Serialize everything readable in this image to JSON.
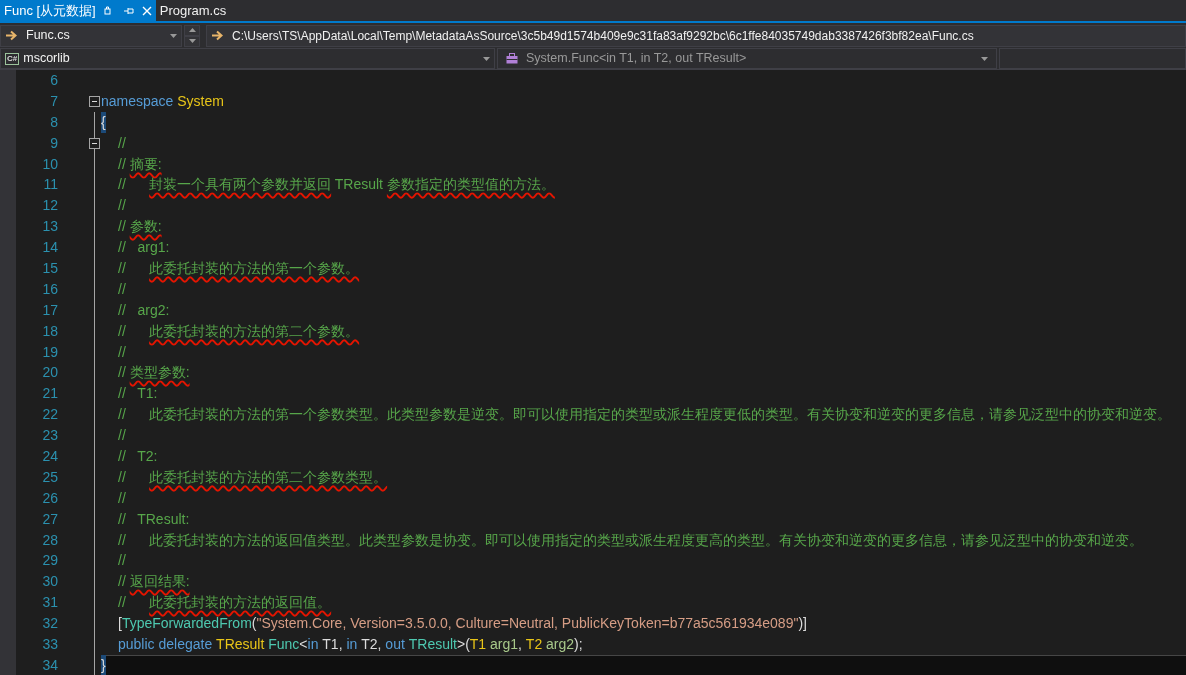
{
  "tabs": [
    {
      "label": "Func [从元数据]",
      "selected": true,
      "pinned": true
    },
    {
      "label": "Program.cs",
      "selected": false,
      "pinned": false
    }
  ],
  "navigation": {
    "file_dropdown": "Func.cs",
    "path": "C:\\Users\\TS\\AppData\\Local\\Temp\\MetadataAsSource\\3c5b49d1574b409e9c31fa83af9292bc\\6c1ffe84035749dab3387426f3bf82ea\\Func.cs",
    "project_icon_text": "C#",
    "project_dropdown": "mscorlib",
    "member_dropdown": "System.Func<in T1, in T2, out TResult>"
  },
  "lines": [
    {
      "number": "6",
      "kind": "blank",
      "fold": false,
      "current": false
    },
    {
      "number": "7",
      "kind": "namespace",
      "fold": true,
      "current": false,
      "tokens": [
        {
          "kind": "keyword",
          "text": "namespace "
        },
        {
          "kind": "typeparam",
          "text": "System"
        }
      ]
    },
    {
      "number": "8",
      "kind": "namespace",
      "fold": false,
      "current": false,
      "tokens": [
        {
          "kind": "brace",
          "text": "{"
        }
      ]
    },
    {
      "number": "9",
      "kind": "member",
      "fold": true,
      "current": false,
      "tokens": [
        {
          "kind": "comment",
          "text": "//",
          "squiggle": false
        }
      ]
    },
    {
      "number": "10",
      "kind": "member",
      "fold": false,
      "current": false,
      "tokens": [
        {
          "kind": "comment",
          "text": "// ",
          "squiggle": false
        },
        {
          "kind": "comment",
          "text": "摘要:",
          "squiggle": true
        }
      ]
    },
    {
      "number": "11",
      "kind": "member",
      "fold": false,
      "current": false,
      "tokens": [
        {
          "kind": "comment",
          "text": "//      ",
          "squiggle": false
        },
        {
          "kind": "comment",
          "text": "封装一个具有两个参数并返回",
          "squiggle": true
        },
        {
          "kind": "comment",
          "text": " TResult ",
          "squiggle": false
        },
        {
          "kind": "comment",
          "text": "参数指定的类型值的方法。",
          "squiggle": true
        }
      ]
    },
    {
      "number": "12",
      "kind": "member",
      "fold": false,
      "current": false,
      "tokens": [
        {
          "kind": "comment",
          "text": "//",
          "squiggle": false
        }
      ]
    },
    {
      "number": "13",
      "kind": "member",
      "fold": false,
      "current": false,
      "tokens": [
        {
          "kind": "comment",
          "text": "// ",
          "squiggle": false
        },
        {
          "kind": "comment",
          "text": "参数:",
          "squiggle": true
        }
      ]
    },
    {
      "number": "14",
      "kind": "member",
      "fold": false,
      "current": false,
      "tokens": [
        {
          "kind": "comment",
          "text": "//   arg1:",
          "squiggle": false
        }
      ]
    },
    {
      "number": "15",
      "kind": "member",
      "fold": false,
      "current": false,
      "tokens": [
        {
          "kind": "comment",
          "text": "//      ",
          "squiggle": false
        },
        {
          "kind": "comment",
          "text": "此委托封装的方法的第一个参数。",
          "squiggle": true
        }
      ]
    },
    {
      "number": "16",
      "kind": "member",
      "fold": false,
      "current": false,
      "tokens": [
        {
          "kind": "comment",
          "text": "//",
          "squiggle": false
        }
      ]
    },
    {
      "number": "17",
      "kind": "member",
      "fold": false,
      "current": false,
      "tokens": [
        {
          "kind": "comment",
          "text": "//   arg2:",
          "squiggle": false
        }
      ]
    },
    {
      "number": "18",
      "kind": "member",
      "fold": false,
      "current": false,
      "tokens": [
        {
          "kind": "comment",
          "text": "//      ",
          "squiggle": false
        },
        {
          "kind": "comment",
          "text": "此委托封装的方法的第二个参数。",
          "squiggle": true
        }
      ]
    },
    {
      "number": "19",
      "kind": "member",
      "fold": false,
      "current": false,
      "tokens": [
        {
          "kind": "comment",
          "text": "//",
          "squiggle": false
        }
      ]
    },
    {
      "number": "20",
      "kind": "member",
      "fold": false,
      "current": false,
      "tokens": [
        {
          "kind": "comment",
          "text": "// ",
          "squiggle": false
        },
        {
          "kind": "comment",
          "text": "类型参数:",
          "squiggle": true
        }
      ]
    },
    {
      "number": "21",
      "kind": "member",
      "fold": false,
      "current": false,
      "tokens": [
        {
          "kind": "comment",
          "text": "//   T1:",
          "squiggle": false
        }
      ]
    },
    {
      "number": "22",
      "kind": "member",
      "fold": false,
      "current": false,
      "tokens": [
        {
          "kind": "comment",
          "text": "//      此委托封装的方法的第一个参数类型。此类型参数是逆变。即可以使用指定的类型或派生程度更低的类型。有关协变和逆变的更多信息，请参见泛型中的协变和逆变。",
          "squiggle": false
        }
      ]
    },
    {
      "number": "23",
      "kind": "member",
      "fold": false,
      "current": false,
      "tokens": [
        {
          "kind": "comment",
          "text": "//",
          "squiggle": false
        }
      ]
    },
    {
      "number": "24",
      "kind": "member",
      "fold": false,
      "current": false,
      "tokens": [
        {
          "kind": "comment",
          "text": "//   T2:",
          "squiggle": false
        }
      ]
    },
    {
      "number": "25",
      "kind": "member",
      "fold": false,
      "current": false,
      "tokens": [
        {
          "kind": "comment",
          "text": "//      ",
          "squiggle": false
        },
        {
          "kind": "comment",
          "text": "此委托封装的方法的第二个参数类型。",
          "squiggle": true
        }
      ]
    },
    {
      "number": "26",
      "kind": "member",
      "fold": false,
      "current": false,
      "tokens": [
        {
          "kind": "comment",
          "text": "//",
          "squiggle": false
        }
      ]
    },
    {
      "number": "27",
      "kind": "member",
      "fold": false,
      "current": false,
      "tokens": [
        {
          "kind": "comment",
          "text": "//   TResult:",
          "squiggle": false
        }
      ]
    },
    {
      "number": "28",
      "kind": "member",
      "fold": false,
      "current": false,
      "tokens": [
        {
          "kind": "comment",
          "text": "//      此委托封装的方法的返回值类型。此类型参数是协变。即可以使用指定的类型或派生程度更高的类型。有关协变和逆变的更多信息，请参见泛型中的协变和逆变。",
          "squiggle": false
        }
      ]
    },
    {
      "number": "29",
      "kind": "member",
      "fold": false,
      "current": false,
      "tokens": [
        {
          "kind": "comment",
          "text": "//",
          "squiggle": false
        }
      ]
    },
    {
      "number": "30",
      "kind": "member",
      "fold": false,
      "current": false,
      "tokens": [
        {
          "kind": "comment",
          "text": "// ",
          "squiggle": false
        },
        {
          "kind": "comment",
          "text": "返回结果:",
          "squiggle": true
        }
      ]
    },
    {
      "number": "31",
      "kind": "member",
      "fold": false,
      "current": false,
      "tokens": [
        {
          "kind": "comment",
          "text": "//      ",
          "squiggle": false
        },
        {
          "kind": "comment",
          "text": "此委托封装的方法的返回值。",
          "squiggle": true
        }
      ]
    },
    {
      "number": "32",
      "kind": "member",
      "fold": false,
      "current": false,
      "tokens": [
        {
          "kind": "plain",
          "text": "["
        },
        {
          "kind": "type",
          "text": "TypeForwardedFrom"
        },
        {
          "kind": "plain",
          "text": "("
        },
        {
          "kind": "string",
          "text": "\"System.Core, Version=3.5.0.0, Culture=Neutral, PublicKeyToken=b77a5c561934e089\""
        },
        {
          "kind": "plain",
          "text": ")]"
        }
      ]
    },
    {
      "number": "33",
      "kind": "member",
      "fold": false,
      "current": false,
      "tokens": [
        {
          "kind": "keyword",
          "text": "public "
        },
        {
          "kind": "keyword",
          "text": "delegate "
        },
        {
          "kind": "typeparam",
          "text": "TResult "
        },
        {
          "kind": "type",
          "text": "Func"
        },
        {
          "kind": "plain",
          "text": "<"
        },
        {
          "kind": "keyword",
          "text": "in "
        },
        {
          "kind": "plain",
          "text": "T1, "
        },
        {
          "kind": "keyword",
          "text": "in "
        },
        {
          "kind": "plain",
          "text": "T2, "
        },
        {
          "kind": "keyword",
          "text": "out "
        },
        {
          "kind": "type",
          "text": "TResult"
        },
        {
          "kind": "plain",
          "text": ">("
        },
        {
          "kind": "typeparam",
          "text": "T1 "
        },
        {
          "kind": "param",
          "text": "arg1"
        },
        {
          "kind": "plain",
          "text": ", "
        },
        {
          "kind": "typeparam",
          "text": "T2 "
        },
        {
          "kind": "param",
          "text": "arg2"
        },
        {
          "kind": "plain",
          "text": ");"
        }
      ]
    },
    {
      "number": "34",
      "kind": "namespace",
      "fold": false,
      "current": true,
      "tokens": [
        {
          "kind": "brace",
          "text": "}"
        }
      ]
    }
  ]
}
